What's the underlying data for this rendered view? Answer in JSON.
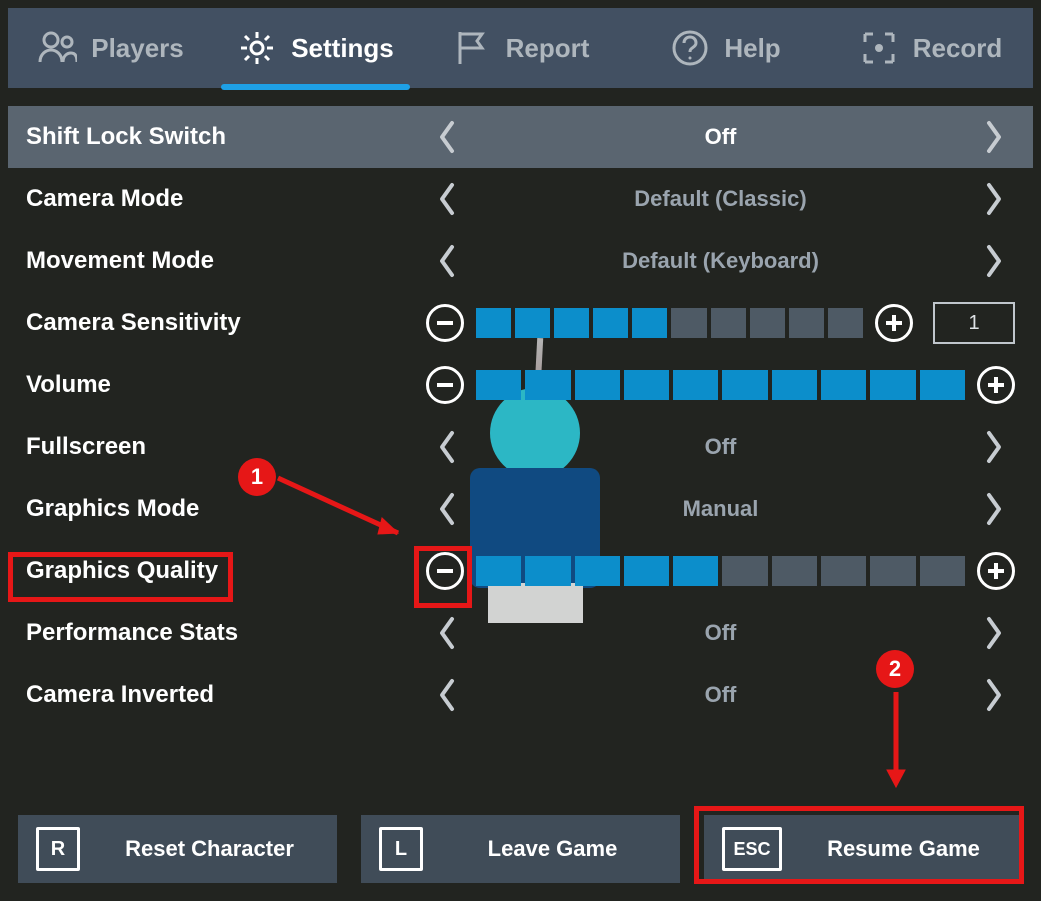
{
  "tabs": {
    "players": "Players",
    "settings": "Settings",
    "report": "Report",
    "help": "Help",
    "record": "Record",
    "active": "settings"
  },
  "settings": {
    "shift_lock": {
      "label": "Shift Lock Switch",
      "value": "Off"
    },
    "camera_mode": {
      "label": "Camera Mode",
      "value": "Default (Classic)"
    },
    "movement_mode": {
      "label": "Movement Mode",
      "value": "Default (Keyboard)"
    },
    "camera_sensitivity": {
      "label": "Camera Sensitivity",
      "filled": 5,
      "total": 10,
      "display": "1"
    },
    "volume": {
      "label": "Volume",
      "filled": 10,
      "total": 10
    },
    "fullscreen": {
      "label": "Fullscreen",
      "value": "Off"
    },
    "graphics_mode": {
      "label": "Graphics Mode",
      "value": "Manual"
    },
    "graphics_quality": {
      "label": "Graphics Quality",
      "filled": 5,
      "total": 10
    },
    "performance_stats": {
      "label": "Performance Stats",
      "value": "Off"
    },
    "camera_inverted": {
      "label": "Camera Inverted",
      "value": "Off"
    }
  },
  "buttons": {
    "reset": {
      "key": "R",
      "label": "Reset Character"
    },
    "leave": {
      "key": "L",
      "label": "Leave Game"
    },
    "resume": {
      "key": "ESC",
      "label": "Resume Game"
    }
  },
  "annotations": {
    "badge1": "1",
    "badge2": "2"
  }
}
